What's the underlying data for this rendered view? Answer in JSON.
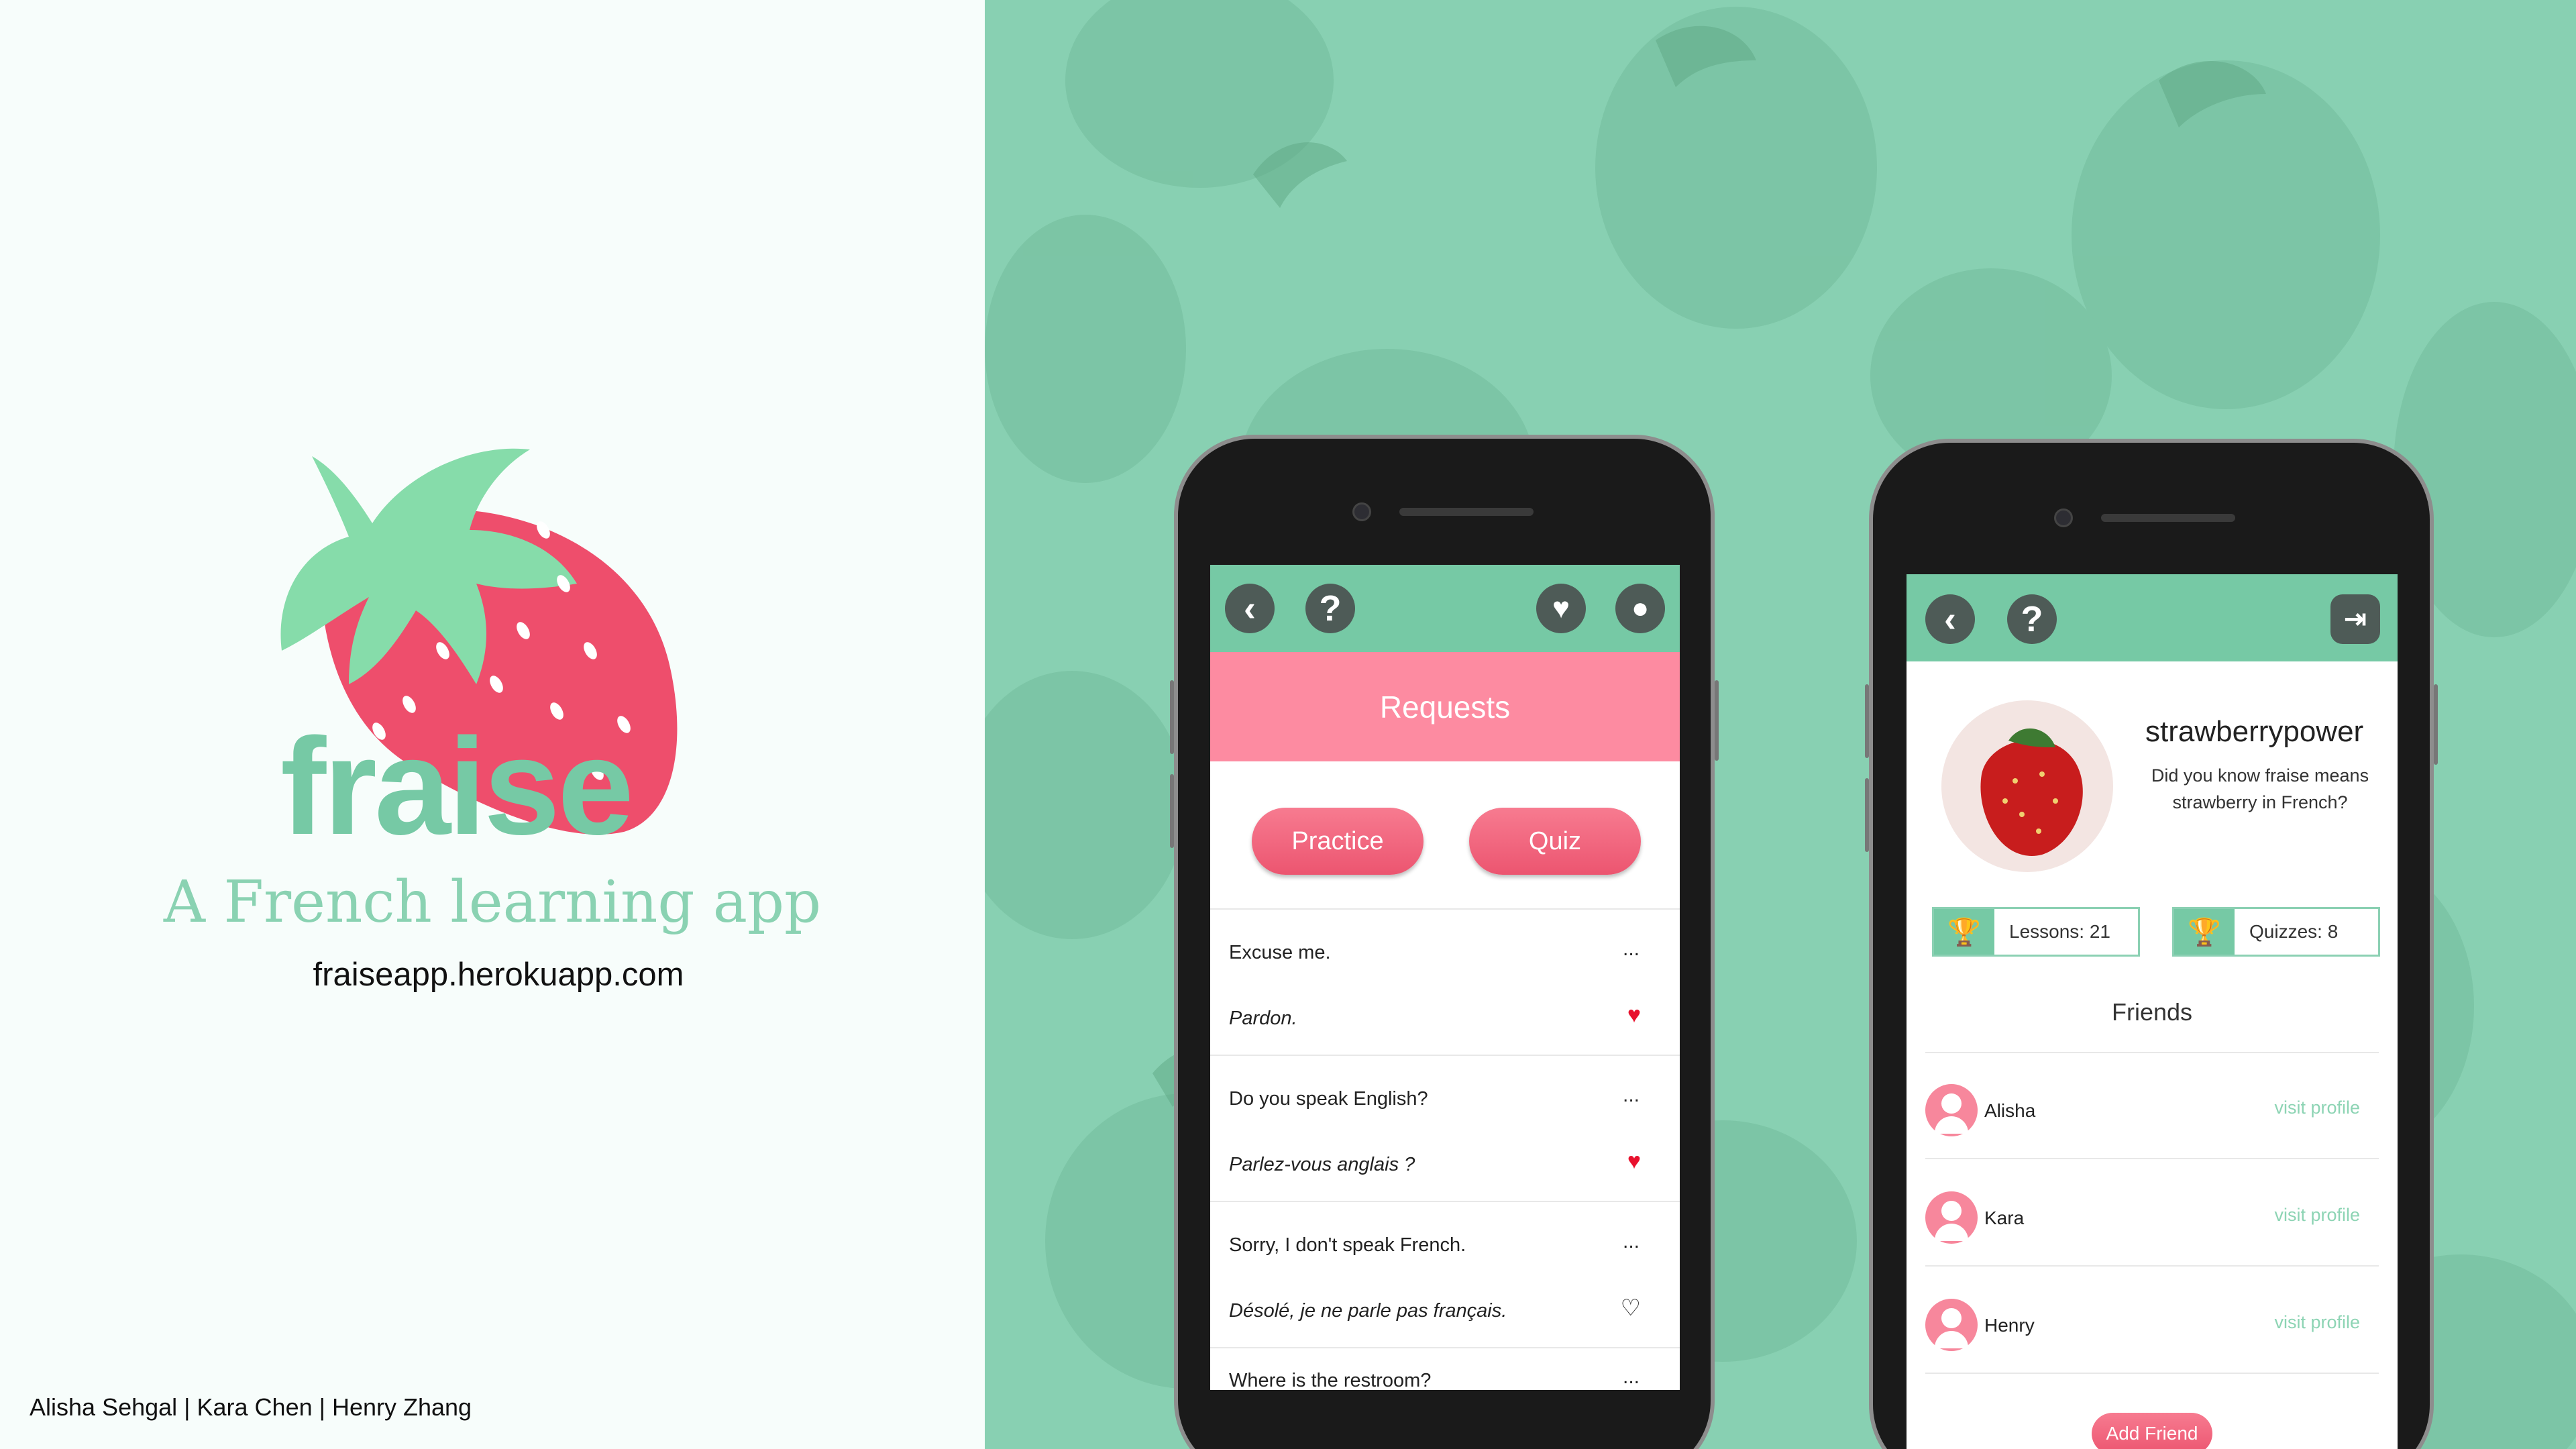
{
  "brand": {
    "name": "fraise",
    "tagline": "A French learning app",
    "url": "fraiseapp.herokuapp.com",
    "credits": "Alisha Sehgal | Kara Chen | Henry Zhang",
    "colors": {
      "mint": "#76c9a5",
      "pink": "#ee4e6c",
      "lightpink": "#fd8ba1"
    }
  },
  "phone1": {
    "icons": [
      "back-icon",
      "help-icon",
      "heart-icon",
      "profile-icon"
    ],
    "banner": "Requests",
    "buttons": {
      "practice": "Practice",
      "quiz": "Quiz"
    },
    "phrases": [
      {
        "en": "Excuse me.",
        "fr": "Pardon.",
        "fav": true
      },
      {
        "en": "Do you speak English?",
        "fr": "Parlez-vous anglais ?",
        "fav": true
      },
      {
        "en": "Sorry, I don't speak French.",
        "fr": "Désolé, je ne parle pas français.",
        "fav": false
      },
      {
        "en": "Where is the restroom?"
      }
    ],
    "more": "..."
  },
  "phone2": {
    "icons": [
      "back-icon",
      "help-icon",
      "logout-icon"
    ],
    "username": "strawberrypower",
    "bio": "Did you know fraise means strawberry in French?",
    "stats": {
      "lessons": "Lessons: 21",
      "quizzes": "Quizzes: 8"
    },
    "friends_title": "Friends",
    "friends": [
      {
        "name": "Alisha",
        "link": "visit profile"
      },
      {
        "name": "Kara",
        "link": "visit profile"
      },
      {
        "name": "Henry",
        "link": "visit profile"
      }
    ],
    "add_friend": "Add Friend"
  }
}
